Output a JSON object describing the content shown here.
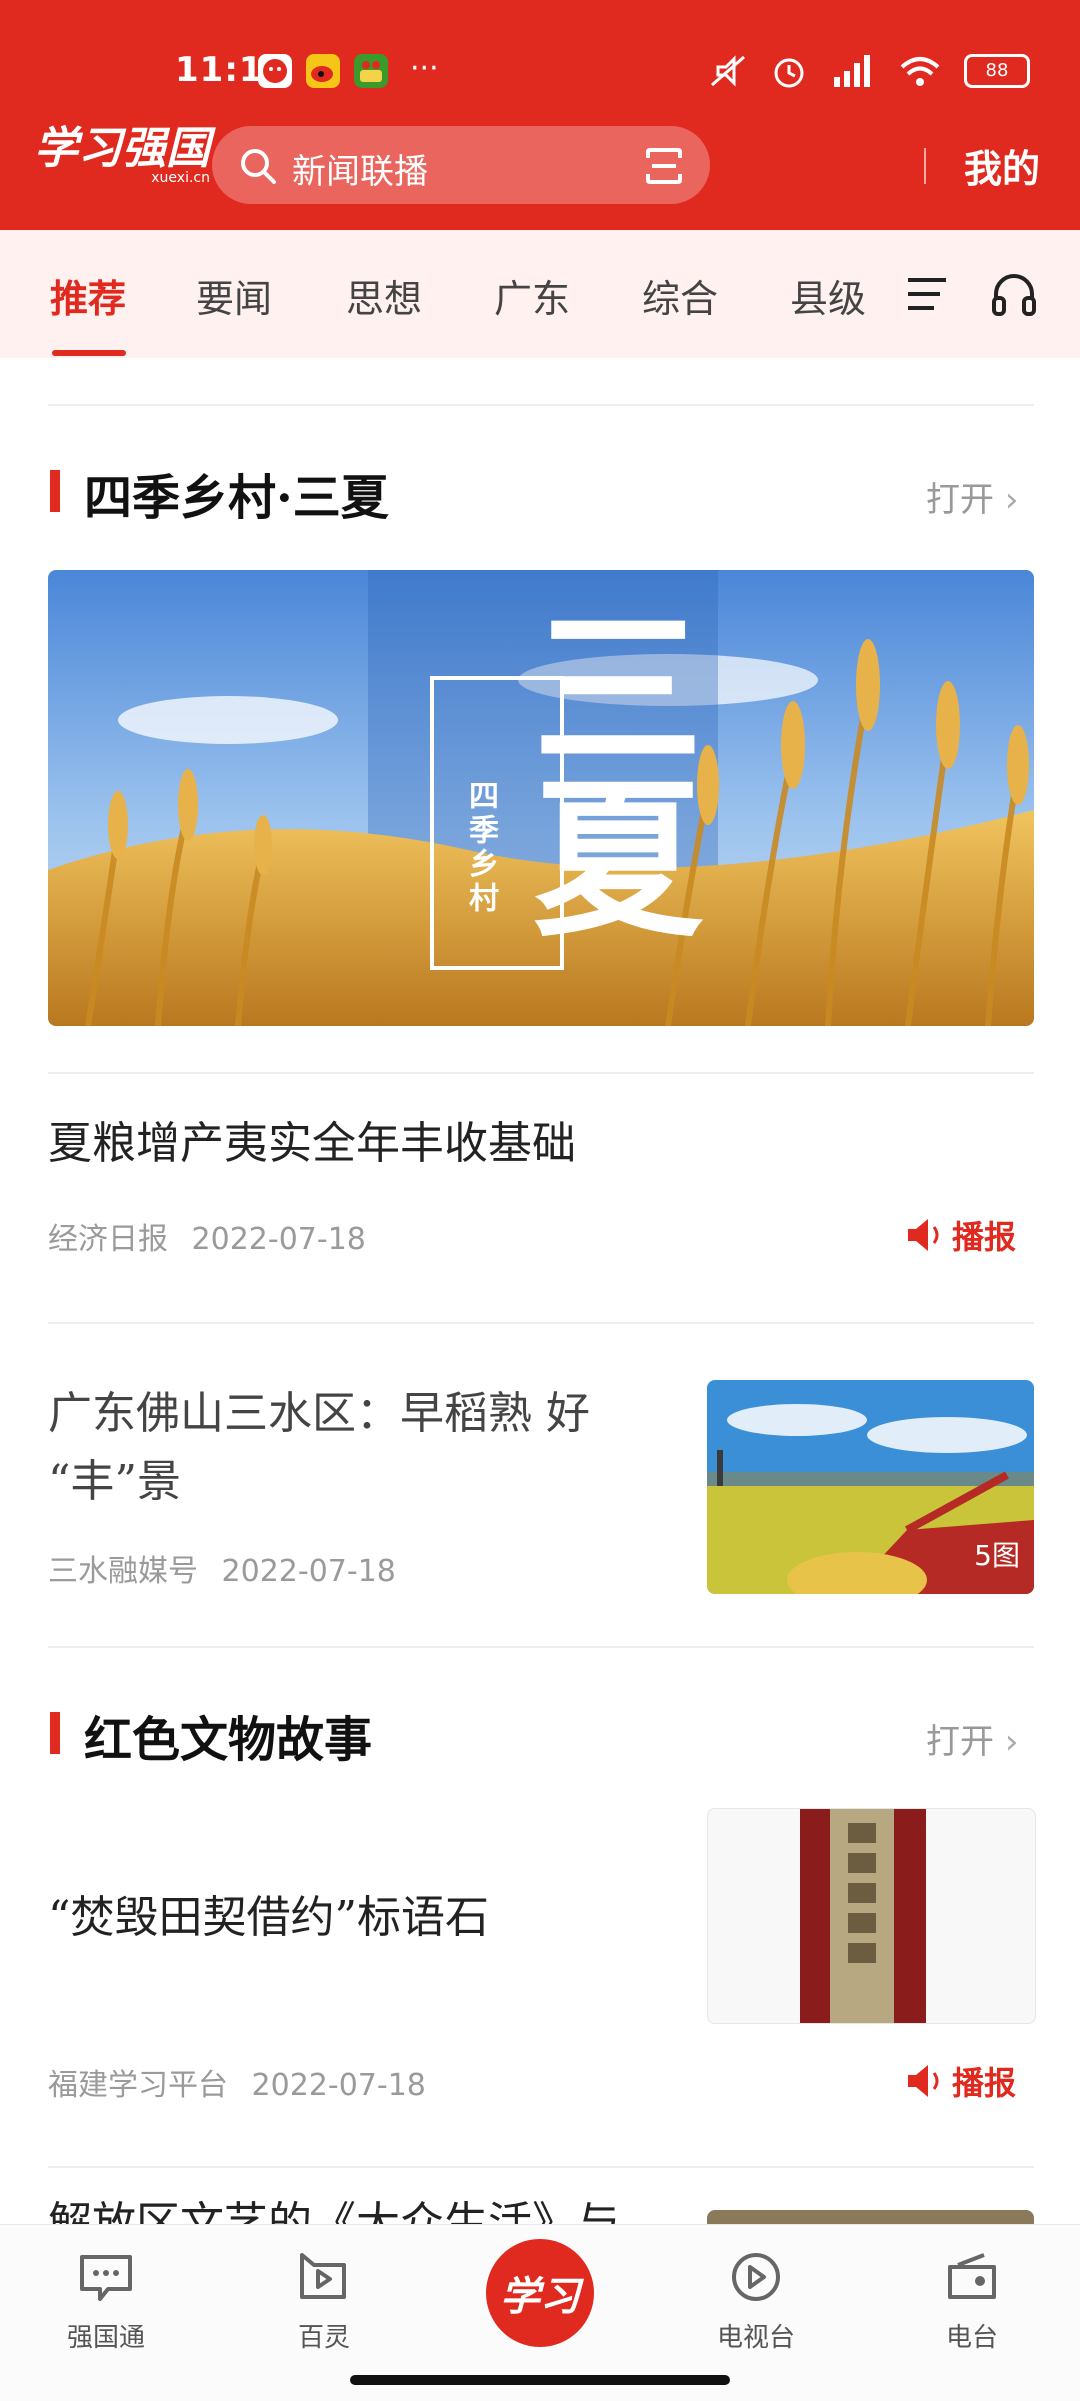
{
  "status_bar": {
    "time": "11:13",
    "more": "···",
    "battery": "88"
  },
  "header": {
    "logo_text": "学习强国",
    "logo_sub": "xuexi.cn",
    "search_placeholder": "新闻联播",
    "mine_label": "我的"
  },
  "tabs": [
    {
      "label": "推荐",
      "active": true
    },
    {
      "label": "要闻"
    },
    {
      "label": "思想"
    },
    {
      "label": "广东"
    },
    {
      "label": "综合"
    },
    {
      "label": "县级"
    }
  ],
  "section1": {
    "title": "四季乡村·三夏",
    "open_label": "打开",
    "banner_big": "三夏",
    "banner_small": "四季乡村"
  },
  "article1": {
    "title": "夏粮增产夷实全年丰收基础",
    "source": "经济日报",
    "date": "2022-07-18",
    "broadcast": "播报"
  },
  "article2": {
    "title_line1": "广东佛山三水区：早稻熟 好",
    "title_line2": "“丰”景",
    "source": "三水融媒号",
    "date": "2022-07-18",
    "image_count": "5图"
  },
  "section2": {
    "title": "红色文物故事",
    "open_label": "打开"
  },
  "article3": {
    "title": "“焚毁田契借约”标语石",
    "source": "福建学习平台",
    "date": "2022-07-18",
    "broadcast": "播报"
  },
  "article4_partial": {
    "title": "解放区文艺的《大众生活》与"
  },
  "bottom_nav": [
    {
      "label": "强国通"
    },
    {
      "label": "百灵"
    },
    {
      "label": "学习"
    },
    {
      "label": "电视台"
    },
    {
      "label": "电台"
    }
  ]
}
